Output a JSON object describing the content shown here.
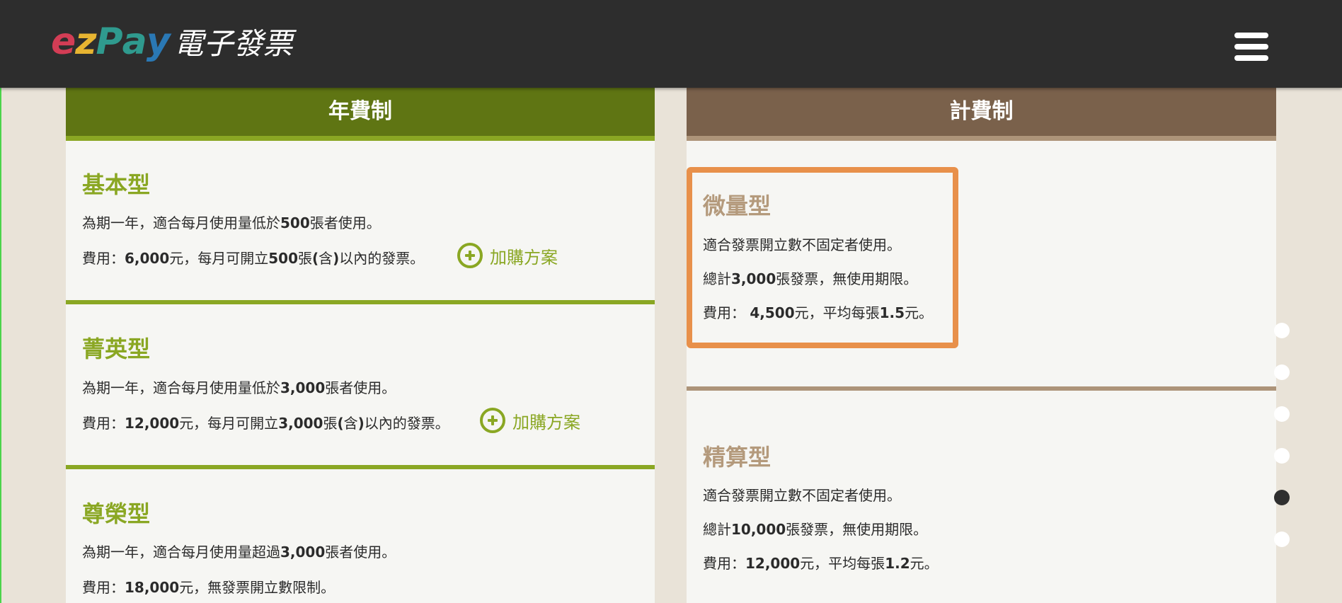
{
  "header": {
    "logo_letters": [
      "e",
      "z",
      "P",
      "a",
      "y"
    ],
    "logo_colors": [
      "#d33d55",
      "#e7b431",
      "#2f9a8e",
      "#2f9a8e",
      "#2a78b4"
    ],
    "logo_suffix": "電子發票",
    "menu_icon": "hamburger-icon"
  },
  "left_column": {
    "heading": "年費制",
    "plans": [
      {
        "title": "基本型",
        "lines": [
          [
            "為期一年，適合每月使用量低於",
            "500",
            "張者使用。"
          ],
          [
            "費用：",
            "6,000",
            "元，每月可開立",
            "500",
            "張",
            "(",
            "含",
            ")",
            "以內的發票。"
          ]
        ],
        "addon_label": "加購方案"
      },
      {
        "title": "菁英型",
        "lines": [
          [
            "為期一年，適合每月使用量低於",
            "3,000",
            "張者使用。"
          ],
          [
            "費用：",
            "12,000",
            "元，每月可開立",
            "3,000",
            "張",
            "(",
            "含",
            ")",
            "以內的發票。"
          ]
        ],
        "addon_label": "加購方案"
      },
      {
        "title": "尊榮型",
        "lines": [
          [
            "為期一年，適合每月使用量超過",
            "3,000",
            "張者使用。"
          ],
          [
            "費用：",
            "18,000",
            "元，無發票開立數限制。"
          ]
        ]
      }
    ]
  },
  "right_column": {
    "heading": "計費制",
    "plans": [
      {
        "title": "微量型",
        "lines": [
          [
            "適合發票開立數不固定者使用。"
          ],
          [
            "總計",
            "3,000",
            "張發票，無使用期限。"
          ],
          [
            "費用： ",
            "4,500",
            "元，平均每張",
            "1.5",
            "元。"
          ]
        ]
      },
      {
        "title": "精算型",
        "lines": [
          [
            "適合發票開立數不固定者使用。"
          ],
          [
            "總計",
            "10,000",
            "張發票，無使用期限。"
          ],
          [
            "費用：",
            "12,000",
            "元，平均每張",
            "1.2",
            "元。"
          ]
        ]
      }
    ]
  },
  "dot_nav": {
    "count": 6,
    "active_index": 4
  },
  "colors": {
    "header_bg": "#2d2d2d",
    "annual_green": "#5f7513",
    "annual_accent": "#8aa723",
    "metered_brown": "#7a614b",
    "metered_accent": "#b49a7c",
    "highlight_orange": "#e8904a"
  }
}
